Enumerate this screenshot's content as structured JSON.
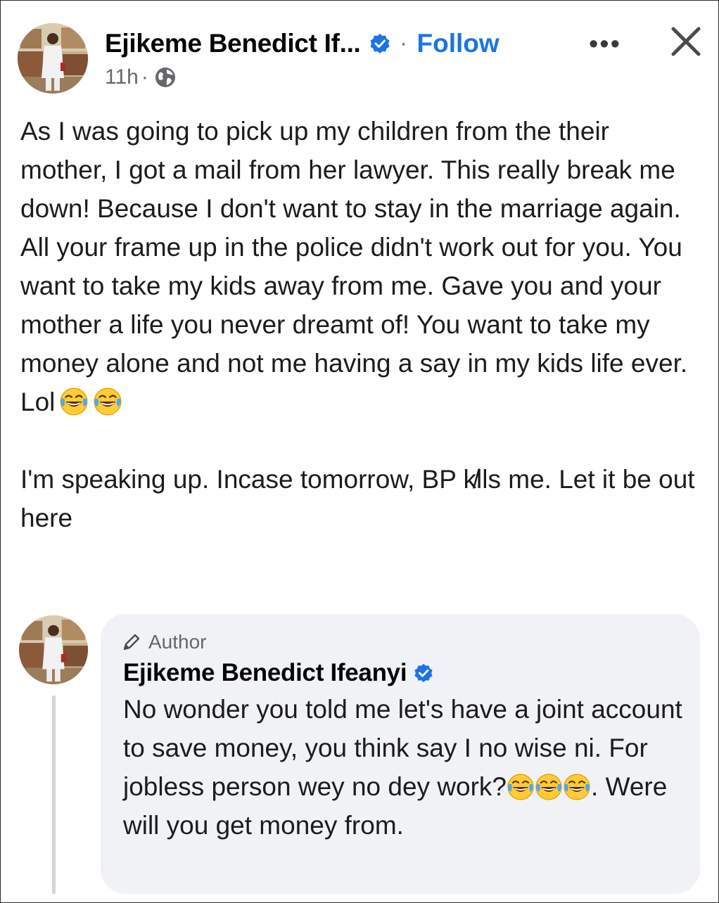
{
  "post": {
    "author_name": "Ejikeme Benedict If...",
    "separator": "·",
    "follow_label": "Follow",
    "more_label": "•••",
    "time": "11h",
    "time_separator": "·",
    "paragraph_1": "As I was going to pick up my children from the their mother, I got a mail from her lawyer. This really break me down! Because I don't want to stay in the marriage again. All your frame up in the police didn't work out for you. You want to take my kids away from me. Gave you and your mother a life you never dreamt of! You want to take my money alone and not me having a say in my kids life ever. Lol",
    "paragraph_2": "I'm speaking up. Incase tomorrow, BP k̸lls me. Let it be out here",
    "icons": {
      "verified": "verified-badge-icon",
      "close": "close-icon",
      "more": "more-options-icon",
      "audience": "globe-icon",
      "emoji": "face-with-tears-of-joy-emoji"
    }
  },
  "comment": {
    "badge_label": "Author",
    "author_name": "Ejikeme Benedict Ifeanyi",
    "text_part_1": "No wonder you told me let's have a joint account to save money, you think say I no wise ni. For jobless person wey no dey work?",
    "text_part_2": ". Were will you get money from."
  },
  "colors": {
    "accent": "#1b74e4",
    "secondary_text": "#65676b",
    "comment_bubble": "#f0f2f5",
    "text": "#1c1c1c"
  }
}
